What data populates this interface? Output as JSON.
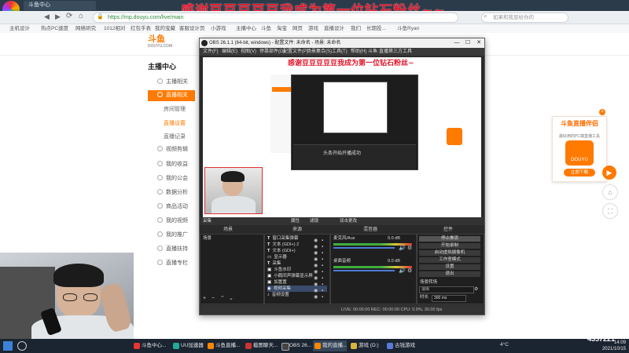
{
  "banner": "感谢豆豆豆豆豆我成为第一位钻石粉丝~~",
  "browser": {
    "tabs": [
      "斗鱼中心",
      "主播中心",
      "斗鱼直播",
      "主播中心",
      "主播中心"
    ],
    "url": "https://mp.douyu.com/live/main",
    "search_placeholder": "如果和我恩给你的",
    "bookmarks": [
      "主机设计",
      "热点PC速度",
      "网络研究",
      "1012相对",
      "红包手表",
      "我的宝藏",
      "客服设计页",
      "小游戏",
      "主播中心",
      "斗鱼",
      "淘宝",
      "网页",
      "游戏",
      "直播设计",
      "我们",
      "长期投...",
      "斗鱼Ryan"
    ]
  },
  "site": {
    "logo": "斗鱼",
    "logo_sub": "DOUYU.COM"
  },
  "sidebar": {
    "title": "主播中心",
    "items": [
      {
        "label": "主播相关",
        "active": false
      },
      {
        "label": "直播相关",
        "active": true
      },
      {
        "label": "视频剪辑",
        "active": false
      },
      {
        "label": "我的收益",
        "active": false
      },
      {
        "label": "我的公会",
        "active": false
      },
      {
        "label": "数据分析",
        "active": false
      },
      {
        "label": "商品活动",
        "active": false
      },
      {
        "label": "我的视频",
        "active": false
      },
      {
        "label": "我的推广",
        "active": false
      },
      {
        "label": "直播扶持",
        "active": false
      },
      {
        "label": "直播专栏",
        "active": false
      }
    ],
    "sub_items": [
      {
        "label": "房间管理",
        "active": false
      },
      {
        "label": "直播设置",
        "active": true
      },
      {
        "label": "直播记录",
        "active": false
      }
    ]
  },
  "promo": {
    "title": "斗鱼直播伴侣",
    "desc": "最好用的PC端直播工具",
    "icon_text": "DOUYU",
    "button": "立即下载"
  },
  "obs": {
    "title": "OBS 26.1.1 (64-bit, windows) - 配置文件: 未命名 - 场景: 未命名",
    "menus": [
      "文件(F)",
      "编辑(E)",
      "视图(V)",
      "停靠部件(D)",
      "配置文件(P)",
      "场景集合(S)",
      "工具(T)",
      "帮助(H)",
      "斗鱼·直播第三方工具"
    ],
    "preview_banner": "感谢豆豆豆豆豆我成为第一位钻石粉丝~",
    "nested_toast": "头条开始开播成功",
    "source_bar": {
      "selected": "采集",
      "properties": "属性",
      "filters": "滤镜",
      "hint": "双击更改"
    },
    "headers": {
      "scenes": "场景",
      "sources": "来源",
      "mixer": "混音器",
      "controls": "控件"
    },
    "scenes": [
      "场景"
    ],
    "sources": [
      "窗口采集弹幕",
      "文本 (GDI+) 2",
      "文本 (GDI+)",
      "显示器",
      "采集",
      "斗鱼水印",
      "小鹅同声弹幕显示屏",
      "加置置",
      "视频采集",
      "音频设置"
    ],
    "mixer": [
      {
        "name": "麦克风/Aux",
        "level": "0.0 dB"
      },
      {
        "name": "桌面音频",
        "level": "0.0 dB"
      }
    ],
    "controls": [
      "停止推流",
      "开始录制",
      "启动虚拟摄像机",
      "工作室模式",
      "设置",
      "退出"
    ],
    "transition": {
      "label": "场景转场",
      "type": "淡出",
      "duration_label": "时长",
      "duration": "300 ms"
    },
    "status": "LIVE: 00:00:00   REC: 00:00:00   CPU: 0.9%, 30.00 fps"
  },
  "taskbar": {
    "tasks": [
      "斗鱼中心...",
      "UU加速器",
      "斗鱼直播...",
      "截图聊天...",
      "OBS 26...",
      "我的直播...",
      "游戏 (D:)",
      "古钱游戏"
    ],
    "temp": "4°C",
    "time": "14:09",
    "date": "2021/10/15"
  },
  "watermark": "斗鱼",
  "watermark_num": "4357221"
}
